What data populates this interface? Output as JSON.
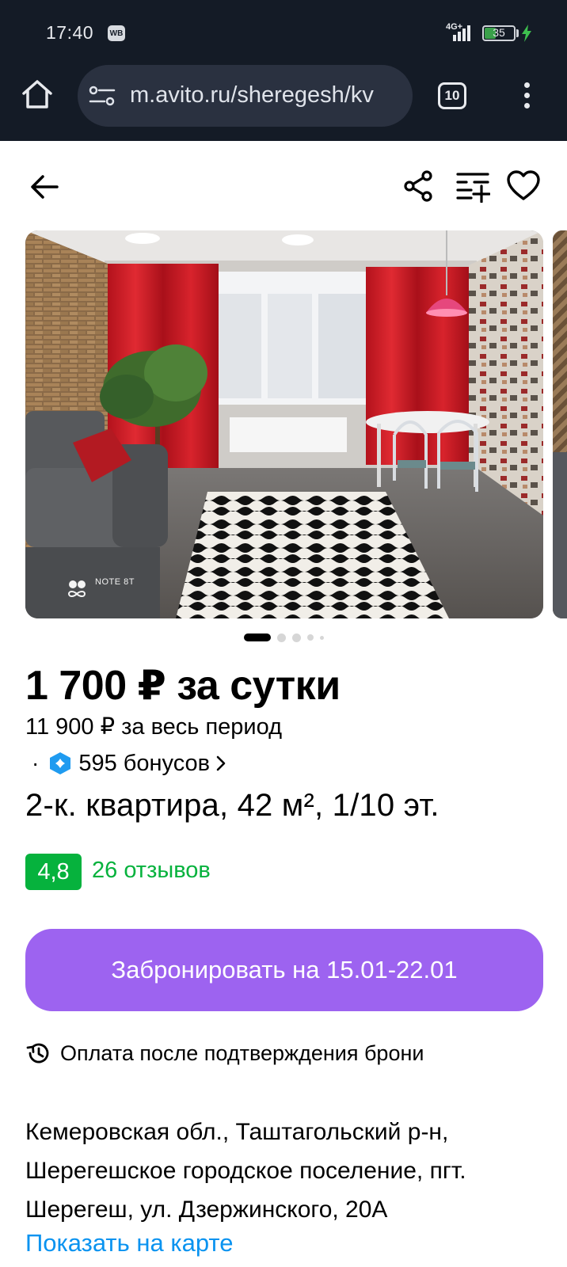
{
  "status_bar": {
    "time": "17:40",
    "app_badge": "WB",
    "network": "4G+",
    "battery": "35"
  },
  "browser": {
    "url": "m.avito.ru/sheregesh/kv",
    "tab_count": "10"
  },
  "listing": {
    "photo": {
      "watermark": "NOTE 8T",
      "current_index": 1,
      "total_dots": 5
    },
    "price": "1 700 ₽ за сутки",
    "period_price": "11 900 ₽ за весь период",
    "bonus_separator": "·",
    "bonus": "595 бонусов",
    "title": "2-к. квартира, 42 м², 1/10 эт.",
    "rating": "4,8",
    "reviews": "26 отзывов",
    "book_button": "Забронировать на 15.01-22.01",
    "payment_note": "Оплата после подтверждения брони",
    "address": "Кемеровская обл., Таштагольский р-н, Шерегешское городское поселение, пгт. Шерегеш, ул. Дзержинского, 20А",
    "map_link": "Показать на карте"
  },
  "colors": {
    "chrome_bg": "#141b26",
    "rating_green": "#06b23d",
    "book_button": "#9d63f0",
    "link_blue": "#0a93f0",
    "bonus_blue": "#1f9bf0"
  },
  "icons": [
    "home-icon",
    "url-tune-icon",
    "tabs-icon",
    "more-vert-icon",
    "back-arrow-icon",
    "share-icon",
    "compare-list-icon",
    "heart-icon",
    "bonus-icon",
    "chevron-right-icon",
    "history-icon"
  ]
}
